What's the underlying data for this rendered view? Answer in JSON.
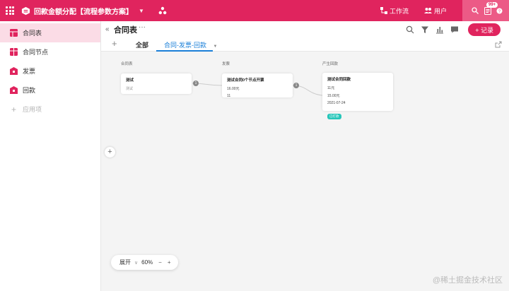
{
  "topbar": {
    "app_title": "回款金额分配【流程参数方案】",
    "nav": [
      {
        "label": "工作流",
        "icon": "workflow-icon"
      },
      {
        "label": "用户",
        "icon": "users-icon"
      }
    ],
    "notification_count": "99+",
    "colors": {
      "brand": "#e0245e"
    }
  },
  "sidebar": {
    "items": [
      {
        "label": "合同表",
        "icon": "table-icon",
        "active": true
      },
      {
        "label": "合同节点",
        "icon": "grid-table-icon"
      },
      {
        "label": "发票",
        "icon": "box-icon"
      },
      {
        "label": "回款",
        "icon": "box-icon"
      }
    ],
    "add_label": "应用项"
  },
  "header": {
    "title": "合同表",
    "record_button": "+ 记录",
    "tabs": [
      {
        "label": "全部"
      },
      {
        "label": "合同-发票-回款",
        "active": true
      }
    ]
  },
  "canvas": {
    "columns": [
      {
        "label": "合同表",
        "cards": [
          {
            "title": "测试",
            "lines": [
              "测试"
            ]
          }
        ]
      },
      {
        "label": "发票",
        "cards": [
          {
            "title": "测试合同0个节点开票",
            "lines": [
              "16.00元",
              "11"
            ]
          }
        ]
      },
      {
        "label": "产生回款",
        "cards": [
          {
            "title": "测试合同回款",
            "lines": [
              "11元",
              "15.00元",
              "2021-07-24"
            ],
            "tag": "已打款"
          }
        ]
      }
    ],
    "connectors": [
      "1",
      "1"
    ]
  },
  "zoom": {
    "expand_label": "展开",
    "level": "60%",
    "minus": "−",
    "plus": "+"
  },
  "watermark": "@稀土掘金技术社区"
}
